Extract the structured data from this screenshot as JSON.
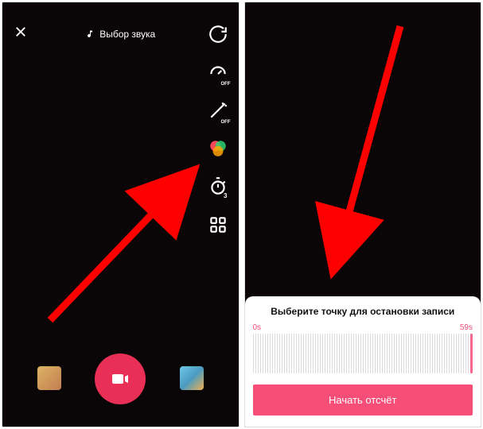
{
  "left": {
    "chooseSound": "Выбор звука",
    "tools": {
      "flip": "flip",
      "speedOff": "OFF",
      "beautyOff": "OFF",
      "timerSub": "3"
    }
  },
  "right": {
    "sheetTitle": "Выберите точку для остановки записи",
    "timeStart": "0s",
    "timeEnd": "59s",
    "startButton": "Начать отсчёт"
  }
}
